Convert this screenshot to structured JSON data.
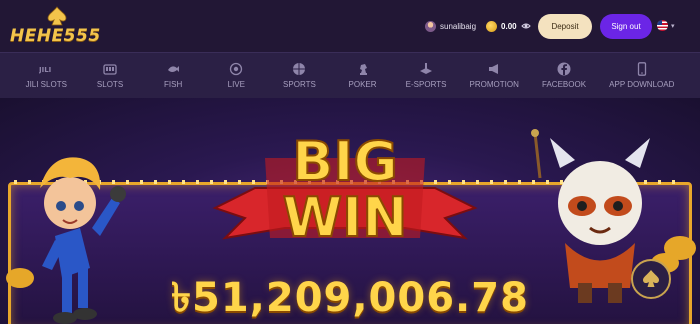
{
  "brand": {
    "logo_text": "HEHE555"
  },
  "header": {
    "username": "sunalibaig",
    "balance": "0.00",
    "deposit_label": "Deposit",
    "signout_label": "Sign out",
    "language_icon": "us-flag-icon"
  },
  "nav": {
    "items": [
      {
        "label": "JILI SLOTS",
        "icon": "jili-icon"
      },
      {
        "label": "SLOTS",
        "icon": "slot-machine-icon"
      },
      {
        "label": "FISH",
        "icon": "fish-icon"
      },
      {
        "label": "LIVE",
        "icon": "live-icon"
      },
      {
        "label": "SPORTS",
        "icon": "ball-icon"
      },
      {
        "label": "POKER",
        "icon": "chess-knight-icon"
      },
      {
        "label": "E-SPORTS",
        "icon": "esports-icon"
      },
      {
        "label": "PROMOTION",
        "icon": "megaphone-icon"
      },
      {
        "label": "FACEBOOK",
        "icon": "facebook-icon"
      },
      {
        "label": "APP DOWNLOAD",
        "icon": "phone-icon"
      }
    ]
  },
  "banner": {
    "headline_line1": "BIG",
    "headline_line2": "WIN",
    "amount": "৳51,209,006.78"
  },
  "colors": {
    "accent_gold": "#ffd54a",
    "primary_purple": "#6b25e6",
    "deposit_bg": "#f4e2bf"
  }
}
